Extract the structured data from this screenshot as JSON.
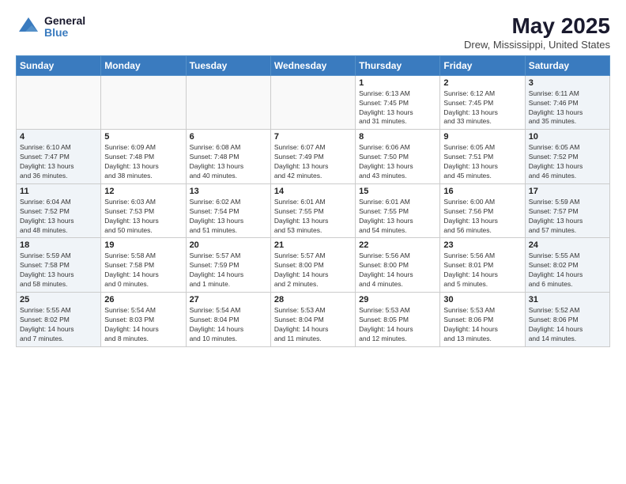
{
  "logo": {
    "general": "General",
    "blue": "Blue"
  },
  "title": "May 2025",
  "location": "Drew, Mississippi, United States",
  "weekdays": [
    "Sunday",
    "Monday",
    "Tuesday",
    "Wednesday",
    "Thursday",
    "Friday",
    "Saturday"
  ],
  "weeks": [
    [
      {
        "day": "",
        "info": ""
      },
      {
        "day": "",
        "info": ""
      },
      {
        "day": "",
        "info": ""
      },
      {
        "day": "",
        "info": ""
      },
      {
        "day": "1",
        "info": "Sunrise: 6:13 AM\nSunset: 7:45 PM\nDaylight: 13 hours\nand 31 minutes."
      },
      {
        "day": "2",
        "info": "Sunrise: 6:12 AM\nSunset: 7:45 PM\nDaylight: 13 hours\nand 33 minutes."
      },
      {
        "day": "3",
        "info": "Sunrise: 6:11 AM\nSunset: 7:46 PM\nDaylight: 13 hours\nand 35 minutes."
      }
    ],
    [
      {
        "day": "4",
        "info": "Sunrise: 6:10 AM\nSunset: 7:47 PM\nDaylight: 13 hours\nand 36 minutes."
      },
      {
        "day": "5",
        "info": "Sunrise: 6:09 AM\nSunset: 7:48 PM\nDaylight: 13 hours\nand 38 minutes."
      },
      {
        "day": "6",
        "info": "Sunrise: 6:08 AM\nSunset: 7:48 PM\nDaylight: 13 hours\nand 40 minutes."
      },
      {
        "day": "7",
        "info": "Sunrise: 6:07 AM\nSunset: 7:49 PM\nDaylight: 13 hours\nand 42 minutes."
      },
      {
        "day": "8",
        "info": "Sunrise: 6:06 AM\nSunset: 7:50 PM\nDaylight: 13 hours\nand 43 minutes."
      },
      {
        "day": "9",
        "info": "Sunrise: 6:05 AM\nSunset: 7:51 PM\nDaylight: 13 hours\nand 45 minutes."
      },
      {
        "day": "10",
        "info": "Sunrise: 6:05 AM\nSunset: 7:52 PM\nDaylight: 13 hours\nand 46 minutes."
      }
    ],
    [
      {
        "day": "11",
        "info": "Sunrise: 6:04 AM\nSunset: 7:52 PM\nDaylight: 13 hours\nand 48 minutes."
      },
      {
        "day": "12",
        "info": "Sunrise: 6:03 AM\nSunset: 7:53 PM\nDaylight: 13 hours\nand 50 minutes."
      },
      {
        "day": "13",
        "info": "Sunrise: 6:02 AM\nSunset: 7:54 PM\nDaylight: 13 hours\nand 51 minutes."
      },
      {
        "day": "14",
        "info": "Sunrise: 6:01 AM\nSunset: 7:55 PM\nDaylight: 13 hours\nand 53 minutes."
      },
      {
        "day": "15",
        "info": "Sunrise: 6:01 AM\nSunset: 7:55 PM\nDaylight: 13 hours\nand 54 minutes."
      },
      {
        "day": "16",
        "info": "Sunrise: 6:00 AM\nSunset: 7:56 PM\nDaylight: 13 hours\nand 56 minutes."
      },
      {
        "day": "17",
        "info": "Sunrise: 5:59 AM\nSunset: 7:57 PM\nDaylight: 13 hours\nand 57 minutes."
      }
    ],
    [
      {
        "day": "18",
        "info": "Sunrise: 5:59 AM\nSunset: 7:58 PM\nDaylight: 13 hours\nand 58 minutes."
      },
      {
        "day": "19",
        "info": "Sunrise: 5:58 AM\nSunset: 7:58 PM\nDaylight: 14 hours\nand 0 minutes."
      },
      {
        "day": "20",
        "info": "Sunrise: 5:57 AM\nSunset: 7:59 PM\nDaylight: 14 hours\nand 1 minute."
      },
      {
        "day": "21",
        "info": "Sunrise: 5:57 AM\nSunset: 8:00 PM\nDaylight: 14 hours\nand 2 minutes."
      },
      {
        "day": "22",
        "info": "Sunrise: 5:56 AM\nSunset: 8:00 PM\nDaylight: 14 hours\nand 4 minutes."
      },
      {
        "day": "23",
        "info": "Sunrise: 5:56 AM\nSunset: 8:01 PM\nDaylight: 14 hours\nand 5 minutes."
      },
      {
        "day": "24",
        "info": "Sunrise: 5:55 AM\nSunset: 8:02 PM\nDaylight: 14 hours\nand 6 minutes."
      }
    ],
    [
      {
        "day": "25",
        "info": "Sunrise: 5:55 AM\nSunset: 8:02 PM\nDaylight: 14 hours\nand 7 minutes."
      },
      {
        "day": "26",
        "info": "Sunrise: 5:54 AM\nSunset: 8:03 PM\nDaylight: 14 hours\nand 8 minutes."
      },
      {
        "day": "27",
        "info": "Sunrise: 5:54 AM\nSunset: 8:04 PM\nDaylight: 14 hours\nand 10 minutes."
      },
      {
        "day": "28",
        "info": "Sunrise: 5:53 AM\nSunset: 8:04 PM\nDaylight: 14 hours\nand 11 minutes."
      },
      {
        "day": "29",
        "info": "Sunrise: 5:53 AM\nSunset: 8:05 PM\nDaylight: 14 hours\nand 12 minutes."
      },
      {
        "day": "30",
        "info": "Sunrise: 5:53 AM\nSunset: 8:06 PM\nDaylight: 14 hours\nand 13 minutes."
      },
      {
        "day": "31",
        "info": "Sunrise: 5:52 AM\nSunset: 8:06 PM\nDaylight: 14 hours\nand 14 minutes."
      }
    ]
  ]
}
